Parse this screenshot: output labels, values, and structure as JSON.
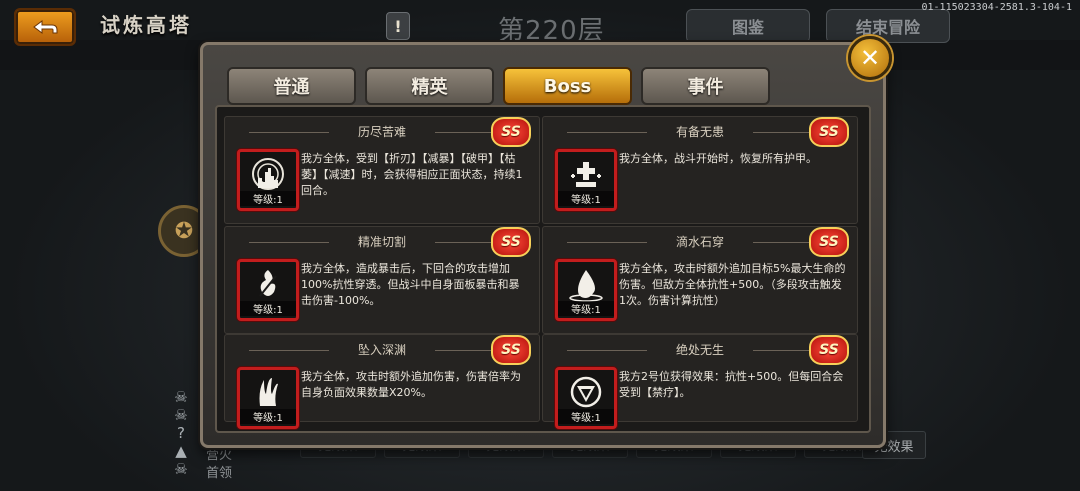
{
  "header": {
    "title": "试炼高塔",
    "floor": "第220层",
    "buttons": [
      "图鉴",
      "结束冒险"
    ],
    "version": "01-115023304-2581.3-104-1"
  },
  "background": {
    "legend": [
      "营火",
      "首领"
    ],
    "cells": [
      "无效果",
      "无效果",
      "无效果",
      "无效果",
      "无效果",
      "无效果",
      "无效果"
    ],
    "last_cell": "无效果"
  },
  "modal": {
    "tabs": [
      "普通",
      "精英",
      "Boss",
      "事件"
    ],
    "active_tab": "Boss",
    "cards": [
      {
        "title": "历尽苦难",
        "badge": "SS",
        "icon": "skyline-icon",
        "level": "等级:1",
        "desc": "我方全体，受到【折刃】【减暴】【破甲】【枯萎】【减速】时，会获得相应正面状态，持续1回合。"
      },
      {
        "title": "有备无患",
        "badge": "SS",
        "icon": "heal-plus-icon",
        "level": "等级:1",
        "desc": "我方全体，战斗开始时，恢复所有护甲。"
      },
      {
        "title": "精准切割",
        "badge": "SS",
        "icon": "flame-blade-icon",
        "level": "等级:1",
        "desc": "我方全体，造成暴击后，下回合的攻击增加100%抗性穿透。但战斗中自身面板暴击和暴击伤害-100%。"
      },
      {
        "title": "滴水石穿",
        "badge": "SS",
        "icon": "water-drop-icon",
        "level": "等级:1",
        "desc": "我方全体，攻击时额外追加目标5%最大生命的伤害。但敌方全体抗性+500。（多段攻击触发1次。伤害计算抗性）"
      },
      {
        "title": "坠入深渊",
        "badge": "SS",
        "icon": "abyss-hand-icon",
        "level": "等级:1",
        "desc": "我方全体，攻击时额外追加伤害，伤害倍率为自身负面效果数量X20%。"
      },
      {
        "title": "绝处无生",
        "badge": "SS",
        "icon": "shield-down-icon",
        "level": "等级:1",
        "desc": "我方2号位获得效果：抗性+500。但每回合会受到【禁疗】。"
      }
    ]
  },
  "colors": {
    "accent": "#f2b532",
    "badge_red": "#d61f18",
    "icon_border": "#c21d1d"
  }
}
